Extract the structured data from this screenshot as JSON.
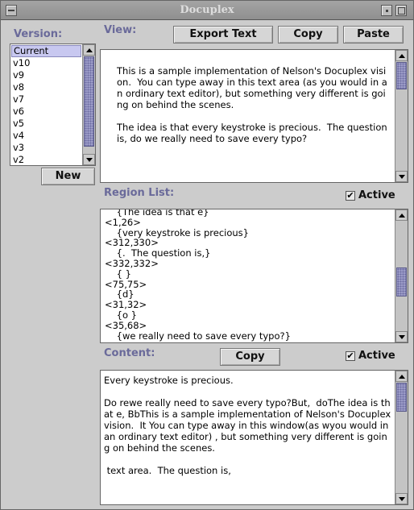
{
  "window": {
    "title": "Docuplex"
  },
  "labels": {
    "version": "Version:",
    "view": "View:",
    "region_list": "Region List:",
    "content": "Content:"
  },
  "buttons": {
    "export_text": "Export Text",
    "copy_view": "Copy",
    "paste": "Paste",
    "new": "New",
    "copy_content": "Copy"
  },
  "versions": [
    "Current",
    "v10",
    "v9",
    "v8",
    "v7",
    "v6",
    "v5",
    "v4",
    "v3",
    "v2"
  ],
  "view_text": "This is a sample implementation of Nelson's Docuplex vision.  You can type away in this text area (as you would in an ordinary text editor), but something very different is going on behind the scenes.\n\nThe idea is that every keystroke is precious.  The question is, do we really need to save every typo?",
  "region_active": {
    "label": "Active",
    "checked": "✔"
  },
  "content_active": {
    "label": "Active",
    "checked": "✔"
  },
  "region_lines": [
    "    {The idea is that e}",
    "<1,26>",
    "    {very keystroke is precious}",
    "<312,330>",
    "    {.  The question is,}",
    "<332,332>",
    "    { }",
    "<75,75>",
    "    {d}",
    "<31,32>",
    "    {o }",
    "<35,68>",
    "    {we really need to save every typo?}"
  ],
  "content_text": "Every keystroke is precious.\n\nDo rewe really need to save every typo?But,  doThe idea is that e, BbThis is a sample implementation of Nelson's Docuplex vision.  It You can type away in this window(as wyou would in an ordinary text editor) , but something very different is going on behind the scenes.\n\n text area.  The question is,"
}
